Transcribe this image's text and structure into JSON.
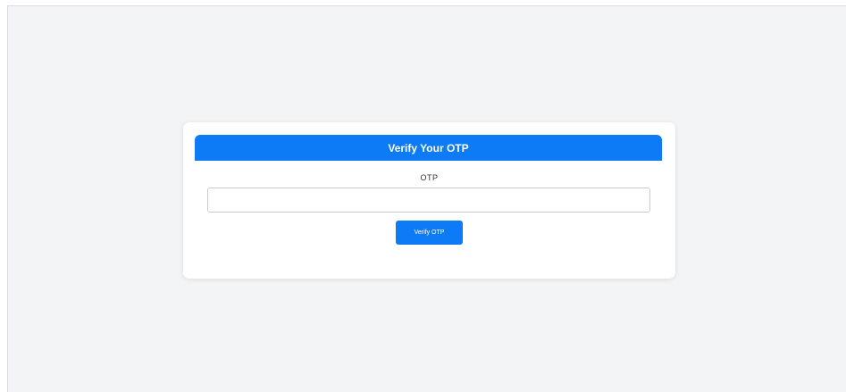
{
  "otp_card": {
    "title": "Verify Your OTP",
    "otp_label": "OTP",
    "otp_value": "",
    "otp_placeholder": "",
    "verify_button_label": "Verify OTP"
  },
  "colors": {
    "accent": "#0d7bf5",
    "background": "#f3f4f6",
    "card": "#ffffff"
  }
}
